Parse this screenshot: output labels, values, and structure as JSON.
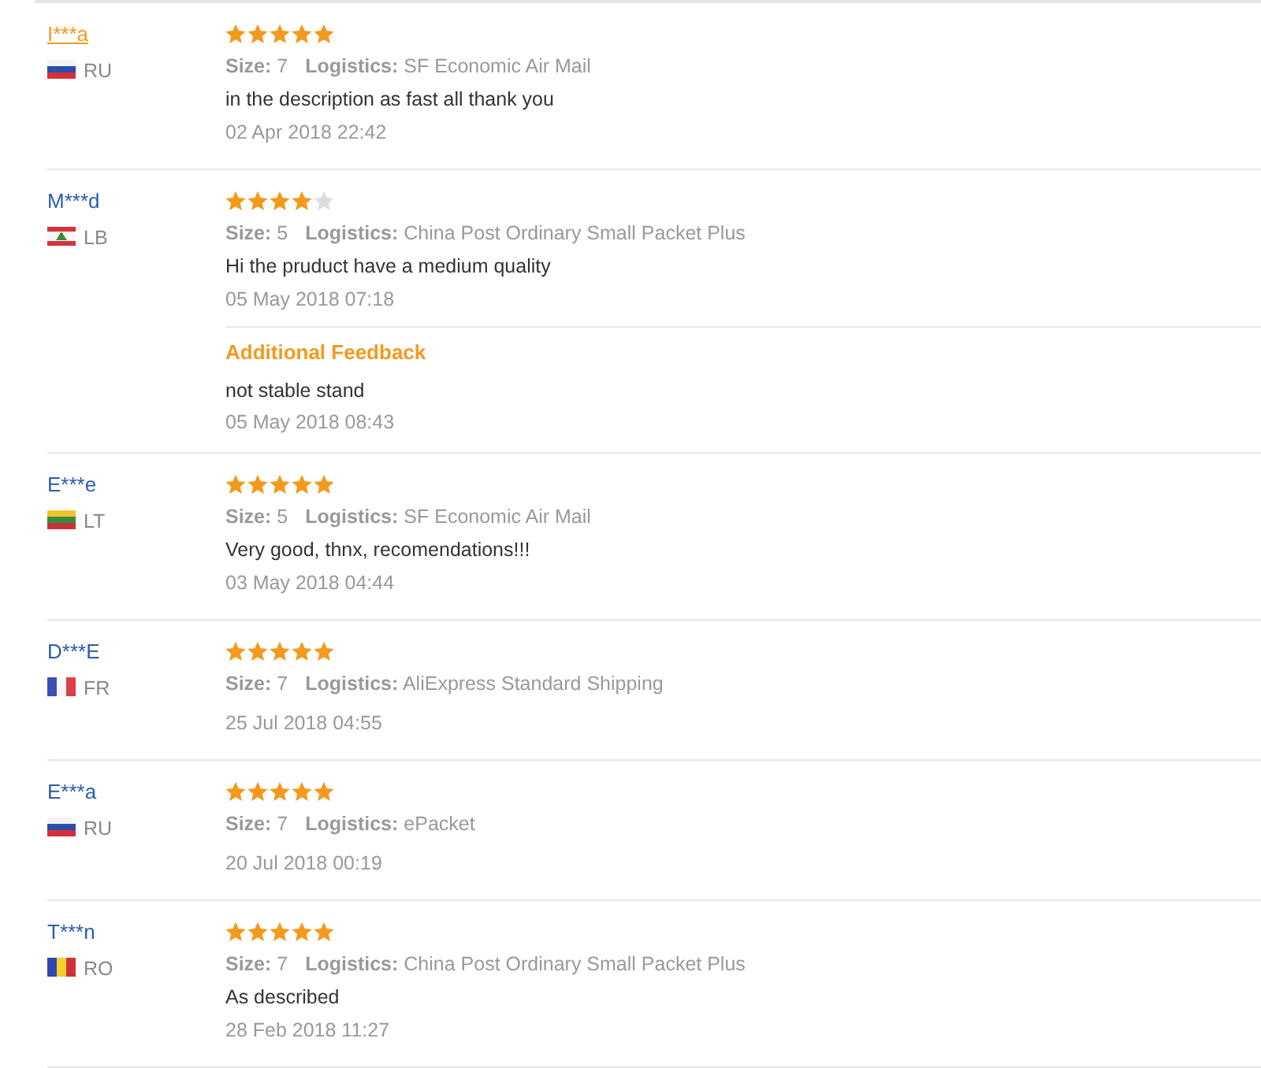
{
  "reviews": [
    {
      "reviewer": {
        "name": "I***a",
        "hovered": true,
        "country": "RU",
        "flag": {
          "kind": "horizontal",
          "stripes": [
            {
              "color": "#f4f4f4"
            },
            {
              "color": "#2a4fa8"
            },
            {
              "color": "#d5303a"
            }
          ]
        }
      },
      "stars": 5,
      "size_label": "Size:",
      "size": "7",
      "logistics_label": "Logistics:",
      "logistics": "SF Economic Air Mail",
      "text": "in the description as fast all thank you",
      "date": "02 Apr 2018 22:42"
    },
    {
      "reviewer": {
        "name": "M***d",
        "hovered": false,
        "country": "LB",
        "flag": {
          "kind": "horizontal",
          "stripes": [
            {
              "color": "#d8323a"
            },
            {
              "color": "#f6f6f6"
            },
            {
              "color": "#f6f6f6"
            },
            {
              "color": "#d8323a"
            }
          ],
          "emblem": {
            "color": "#3f8a3a"
          }
        }
      },
      "stars": 4,
      "size_label": "Size:",
      "size": "5",
      "logistics_label": "Logistics:",
      "logistics": "China Post Ordinary Small Packet Plus",
      "text": "Hi the pruduct have a medium quality",
      "date": "05 May 2018 07:18",
      "additional": {
        "title": "Additional Feedback",
        "text": "not stable stand",
        "date": "05 May 2018 08:43"
      }
    },
    {
      "reviewer": {
        "name": "E***e",
        "hovered": false,
        "country": "LT",
        "flag": {
          "kind": "horizontal",
          "stripes": [
            {
              "color": "#f2c42c"
            },
            {
              "color": "#3a8a3c"
            },
            {
              "color": "#c8323a"
            }
          ]
        }
      },
      "stars": 5,
      "size_label": "Size:",
      "size": "5",
      "logistics_label": "Logistics:",
      "logistics": "SF Economic Air Mail",
      "text": "Very good, thnx, recomendations!!!",
      "date": "03 May 2018 04:44"
    },
    {
      "reviewer": {
        "name": "D***E",
        "hovered": false,
        "country": "FR",
        "flag": {
          "kind": "vertical",
          "stripes": [
            {
              "color": "#3a4fb8"
            },
            {
              "color": "#f6f6f6"
            },
            {
              "color": "#d8404a"
            }
          ]
        }
      },
      "stars": 5,
      "size_label": "Size:",
      "size": "7",
      "logistics_label": "Logistics:",
      "logistics": "AliExpress Standard Shipping",
      "date": "25 Jul 2018 04:55"
    },
    {
      "reviewer": {
        "name": "E***a",
        "hovered": false,
        "country": "RU",
        "flag": {
          "kind": "horizontal",
          "stripes": [
            {
              "color": "#f4f4f4"
            },
            {
              "color": "#2a4fa8"
            },
            {
              "color": "#d5303a"
            }
          ]
        }
      },
      "stars": 5,
      "size_label": "Size:",
      "size": "7",
      "logistics_label": "Logistics:",
      "logistics": "ePacket",
      "date": "20 Jul 2018 00:19"
    },
    {
      "reviewer": {
        "name": "T***n",
        "hovered": false,
        "country": "RO",
        "flag": {
          "kind": "vertical",
          "stripes": [
            {
              "color": "#2f46b0"
            },
            {
              "color": "#f3d02c"
            },
            {
              "color": "#d03238"
            }
          ]
        }
      },
      "stars": 5,
      "size_label": "Size:",
      "size": "7",
      "logistics_label": "Logistics:",
      "logistics": "China Post Ordinary Small Packet Plus",
      "text": "As described",
      "date": "28 Feb 2018 11:27"
    }
  ]
}
